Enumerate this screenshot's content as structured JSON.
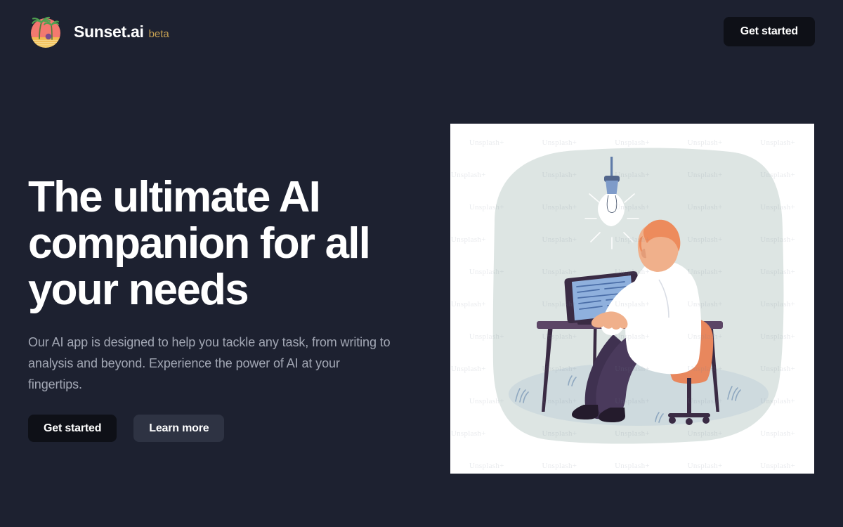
{
  "header": {
    "logo_icon": "sunset-palm-island-icon",
    "brand_name": "Sunset.ai",
    "brand_tag": "beta",
    "cta_label": "Get started"
  },
  "hero": {
    "title": "The ultimate AI companion for all your needs",
    "subtitle": "Our AI app is designed to help you tackle any task, from writing to analysis and beyond. Experience the power of AI at your fingertips.",
    "primary_cta": "Get started",
    "secondary_cta": "Learn more",
    "illustration_name": "man-working-at-desk-with-monitor-and-lightbulb-illustration",
    "illustration_watermark": "Unsplash+"
  },
  "colors": {
    "page_background": "#1d2130",
    "brand_tag": "#c6a052",
    "primary_button": "#0e1017",
    "secondary_button": "#2e3343",
    "heading_text": "#ffffff",
    "body_text": "#a2a7b4",
    "illustration_blob": "#dce5e3",
    "illustration_accent_orange": "#e8875d",
    "illustration_accent_purple": "#463352",
    "illustration_accent_blue": "#8ea8d4"
  }
}
